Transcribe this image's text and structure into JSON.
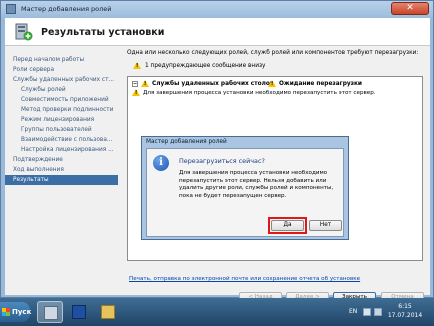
{
  "window": {
    "title": "Мастер добавления ролей",
    "close_label": "✕"
  },
  "header": {
    "title": "Результаты установки"
  },
  "nav": {
    "items": [
      {
        "label": "Перед началом работы",
        "sub": false,
        "active": false
      },
      {
        "label": "Роли сервера",
        "sub": false,
        "active": false
      },
      {
        "label": "Службы удаленных рабочих ст...",
        "sub": false,
        "active": false
      },
      {
        "label": "Службы ролей",
        "sub": true,
        "active": false
      },
      {
        "label": "Совместимость приложений",
        "sub": true,
        "active": false
      },
      {
        "label": "Метод проверки подлинности",
        "sub": true,
        "active": false
      },
      {
        "label": "Режим лицензирования",
        "sub": true,
        "active": false
      },
      {
        "label": "Группы пользователей",
        "sub": true,
        "active": false
      },
      {
        "label": "Взаимодействие с пользова...",
        "sub": true,
        "active": false
      },
      {
        "label": "Настройка лицензирования ...",
        "sub": true,
        "active": false
      },
      {
        "label": "Подтверждение",
        "sub": false,
        "active": false
      },
      {
        "label": "Ход выполнения",
        "sub": false,
        "active": false
      },
      {
        "label": "Результаты",
        "sub": false,
        "active": true
      }
    ]
  },
  "content": {
    "intro": "Одна или несколько следующих ролей, служб ролей или компонентов требуют перезагрузки:",
    "summary": "1 предупреждающее сообщение внизу",
    "role_name": "Службы удаленных рабочих столов",
    "role_status": "Ожидание перезагрузки",
    "detail": "Для завершения процесса установки необходимо перезапустить этот сервер.",
    "link": "Печать, отправка по электронной почте или сохранение отчета об установке"
  },
  "buttons": {
    "back": "< Назад",
    "next": "Далее >",
    "close": "Закрыть",
    "cancel": "Отмена"
  },
  "dialog": {
    "title": "Мастер добавления ролей",
    "question": "Перезагрузиться сейчас?",
    "message": "Для завершения процесса установки необходимо перезапустить этот сервер. Нельзя добавить или удалить другие роли, службы ролей и компоненты, пока не будет перезапущен сервер.",
    "yes": "Да",
    "no": "Нет"
  },
  "taskbar": {
    "start": "Пуск",
    "lang": "EN",
    "time": "6:15",
    "date": "17.07.2014"
  }
}
